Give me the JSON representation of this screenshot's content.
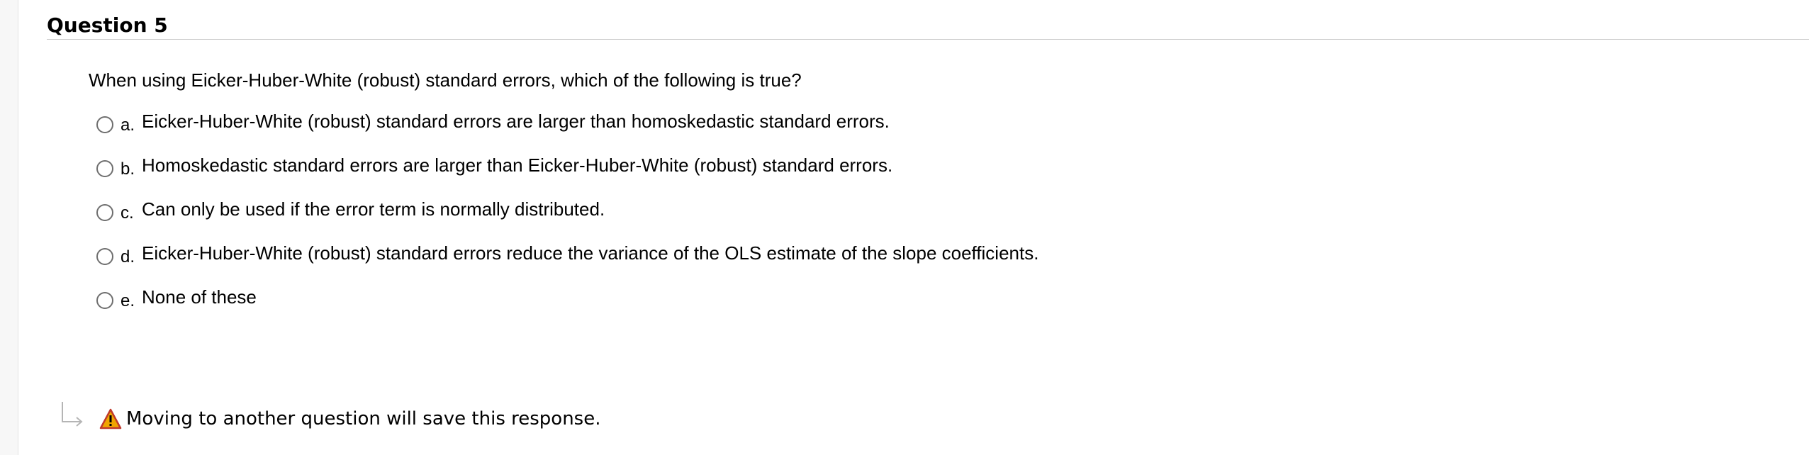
{
  "question": {
    "title": "Question 5",
    "prompt": "When using Eicker-Huber-White (robust) standard errors, which of the following is true?"
  },
  "options": [
    {
      "letter": "a.",
      "text": "Eicker-Huber-White (robust) standard errors are larger than homoskedastic standard errors."
    },
    {
      "letter": "b.",
      "text": "Homoskedastic standard errors are larger than Eicker-Huber-White (robust) standard errors."
    },
    {
      "letter": "c.",
      "text": "Can only be used if the error term is normally distributed."
    },
    {
      "letter": "d.",
      "text": "Eicker-Huber-White (robust) standard errors reduce the variance of the OLS estimate of the slope coefficients."
    },
    {
      "letter": "e.",
      "text": "None of these"
    }
  ],
  "footer": {
    "save_note": "Moving to another question will save this response.",
    "arrow_icon": "return-arrow-icon",
    "warning_icon": "warning-icon",
    "warning_color": "#f0a500"
  }
}
